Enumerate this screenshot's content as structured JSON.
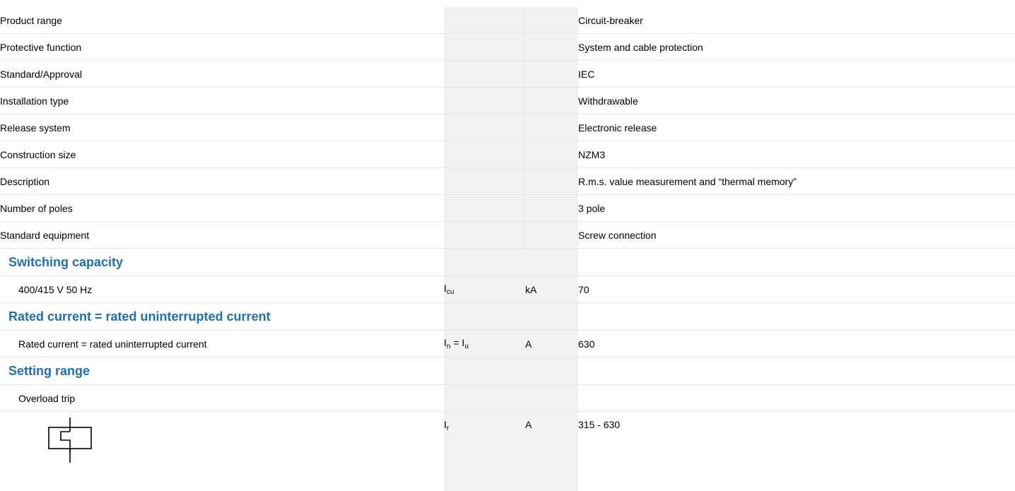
{
  "rows": [
    {
      "label": "Product range",
      "value": "Circuit-breaker"
    },
    {
      "label": "Protective function",
      "value": "System and cable protection"
    },
    {
      "label": "Standard/Approval",
      "value": "IEC"
    },
    {
      "label": "Installation type",
      "value": "Withdrawable"
    },
    {
      "label": "Release system",
      "value": "Electronic release"
    },
    {
      "label": "Construction size",
      "value": "NZM3"
    },
    {
      "label": "Description",
      "value": "R.m.s. value measurement and “thermal memory”"
    },
    {
      "label": "Number of poles",
      "value": "3 pole"
    },
    {
      "label": "Standard equipment",
      "value": "Screw connection"
    }
  ],
  "switching_capacity": {
    "heading": "Switching capacity",
    "row": {
      "label": "400/415 V 50 Hz",
      "symbol_main": "I",
      "symbol_sub": "cu",
      "unit": "kA",
      "value": "70"
    }
  },
  "rated_current": {
    "heading": "Rated current = rated uninterrupted current",
    "row": {
      "label": "Rated current = rated uninterrupted current",
      "symbol_a_main": "I",
      "symbol_a_sub": "n",
      "symbol_eq": " = ",
      "symbol_b_main": "I",
      "symbol_b_sub": "u",
      "unit": "A",
      "value": "630"
    }
  },
  "setting_range": {
    "heading": "Setting range",
    "subheading": "Overload trip",
    "row": {
      "symbol_icon": "overload-trip-symbol-icon",
      "symbol_main": "I",
      "symbol_sub": "r",
      "unit": "A",
      "value": "315 - 630"
    }
  }
}
